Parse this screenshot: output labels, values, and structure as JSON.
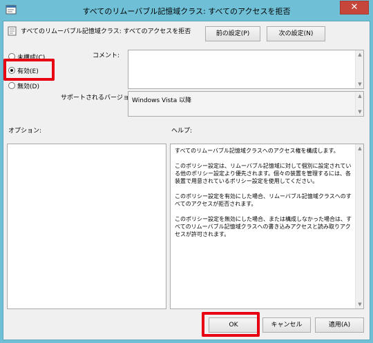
{
  "window": {
    "title": "すべてのリムーバブル記憶域クラス: すべてのアクセスを拒否",
    "close_label": "✕"
  },
  "header": {
    "policy_name": "すべてのリムーバブル記憶域クラス: すべてのアクセスを拒否",
    "prev_button": "前の設定(P)",
    "next_button": "次の設定(N)"
  },
  "state": {
    "options": [
      {
        "label": "未構成(C)",
        "checked": false
      },
      {
        "label": "有効(E)",
        "checked": true
      },
      {
        "label": "無効(D)",
        "checked": false
      }
    ]
  },
  "comment": {
    "label": "コメント:",
    "value": ""
  },
  "supported": {
    "label": "サポートされるバージョン:",
    "value": "Windows Vista 以降"
  },
  "options_section": {
    "label": "オプション:"
  },
  "help_section": {
    "label": "ヘルプ:",
    "paragraphs": [
      "すべてのリムーバブル記憶域クラスへのアクセス権を構成します。",
      "このポリシー設定は、リムーバブル記憶域に対して個別に設定されている他のポリシー設定より優先されます。個々の装置を管理するには、各装置で用意されているポリシー設定を使用してください。",
      "このポリシー設定を有効にした場合、リムーバブル記憶域クラスへのすべてのアクセスが拒否されます。",
      "このポリシー設定を無効にした場合、または構成しなかった場合は、すべてのリムーバブル記憶域クラスへの書き込みアクセスと読み取りアクセスが許可されます。"
    ]
  },
  "footer": {
    "ok": "OK",
    "cancel": "キャンセル",
    "apply": "適用(A)"
  },
  "colors": {
    "highlight": "#e60012",
    "titlebar": "#6fc0d6",
    "close": "#c7463c"
  }
}
